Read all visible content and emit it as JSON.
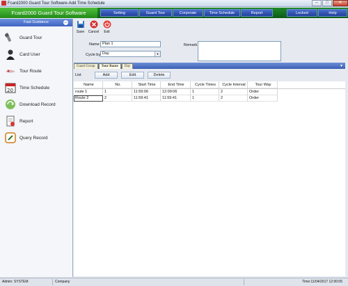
{
  "window": {
    "title": "Fcard2000 Guard Tour Software-Add Time Schedule",
    "min": "–",
    "max": "□",
    "close": "✕"
  },
  "menubar": {
    "brand": "Fcard2000 Guard Tour Software",
    "items": [
      "Setting",
      "Guard Tour",
      "Corporate",
      "Time Schedule",
      "Report"
    ],
    "locked": "Locked",
    "help": "Help"
  },
  "sidebar": {
    "header": "Fast Guidance",
    "items": [
      {
        "label": "Guard Tour",
        "icon": "guard-tour-icon"
      },
      {
        "label": "Card User",
        "icon": "card-user-icon"
      },
      {
        "label": "Tour Route",
        "icon": "tour-route-icon"
      },
      {
        "label": "Time Schedule",
        "icon": "calendar-icon"
      },
      {
        "label": "Download Record",
        "icon": "download-icon"
      },
      {
        "label": "Report",
        "icon": "report-icon"
      },
      {
        "label": "Query Record",
        "icon": "query-icon"
      }
    ]
  },
  "toolbar": {
    "save": "Save",
    "cancel": "Cancel",
    "exit": "Exit"
  },
  "form": {
    "name_label": "Name",
    "name_value": "Plan 1",
    "cycle_label": "Cycle by",
    "cycle_value": "Day",
    "remark_label": "Remark",
    "remark_value": ""
  },
  "tabs": [
    "Guard Group",
    "Tour Route",
    "Day"
  ],
  "list": {
    "label": "List",
    "add": "Add",
    "edit": "Edit",
    "delete": "Delete"
  },
  "grid": {
    "columns": [
      "Name",
      "No.",
      "Start Time",
      "End Time",
      "Cycle Times",
      "Cycle Interval",
      "Tour Way"
    ],
    "rows": [
      [
        "route 1",
        "1",
        "11:59:06",
        "12:09:06",
        "1",
        "2",
        "Order"
      ],
      [
        "Route 2",
        "2",
        "11:59:41",
        "11:59:41",
        "1",
        "2",
        "Order"
      ]
    ]
  },
  "status": {
    "admin": "Admin: SYSTEM",
    "company": "Company",
    "time": "Time:11/04/2017 12:00:05"
  },
  "colors": {
    "menu_green": "#0c5a16",
    "menu_blue": "#1f3f9a",
    "sidebar_header": "#3d63c0"
  }
}
